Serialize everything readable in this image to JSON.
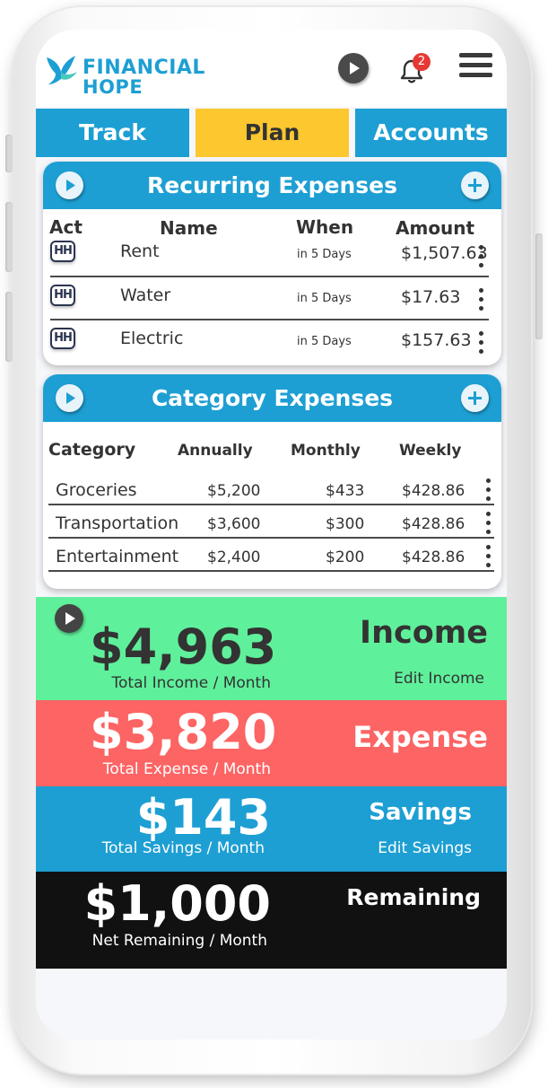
{
  "app": {
    "brand_line1": "FINANCIAL",
    "brand_line2": "HOPE",
    "notification_count": "2"
  },
  "tabs": [
    {
      "label": "Track",
      "active": false
    },
    {
      "label": "Plan",
      "active": true
    },
    {
      "label": "Accounts",
      "active": false
    }
  ],
  "recurring": {
    "title": "Recurring Expenses",
    "columns": {
      "act": "Act",
      "name": "Name",
      "when": "When",
      "amount": "Amount"
    },
    "rows": [
      {
        "act_icon": "HH",
        "name": "Rent",
        "when": "in 5 Days",
        "amount": "$1,507.63"
      },
      {
        "act_icon": "HH",
        "name": "Water",
        "when": "in 5 Days",
        "amount": "$17.63"
      },
      {
        "act_icon": "HH",
        "name": "Electric",
        "when": "in 5 Days",
        "amount": "$157.63"
      }
    ]
  },
  "category": {
    "title": "Category Expenses",
    "columns": {
      "category": "Category",
      "annually": "Annually",
      "monthly": "Monthly",
      "weekly": "Weekly"
    },
    "rows": [
      {
        "name": "Groceries",
        "annually": "$5,200",
        "monthly": "$433",
        "weekly": "$428.86"
      },
      {
        "name": "Transportation",
        "annually": "$3,600",
        "monthly": "$300",
        "weekly": "$428.86"
      },
      {
        "name": "Entertainment",
        "annually": "$2,400",
        "monthly": "$200",
        "weekly": "$428.86"
      }
    ]
  },
  "summary": {
    "income": {
      "amount": "$4,963",
      "caption": "Total Income / Month",
      "title": "Income",
      "action": "Edit Income"
    },
    "expense": {
      "amount": "$3,820",
      "caption": "Total Expense / Month",
      "title": "Expense"
    },
    "savings": {
      "amount": "$143",
      "caption": "Total Savings / Month",
      "title": "Savings",
      "action": "Edit Savings"
    },
    "remaining": {
      "amount": "$1,000",
      "caption": "Net Remaining / Month",
      "title": "Remaining"
    }
  },
  "colors": {
    "brand_blue": "#1d9fd3",
    "tab_active": "#fcc72f",
    "income_green": "#5ff09b",
    "expense_red": "#fd6464",
    "savings_blue": "#1d9fd3",
    "remaining_black": "#111111"
  },
  "icons": [
    "bird-logo-icon",
    "play-icon",
    "bell-icon",
    "menu-icon",
    "add-icon",
    "kebab-menu-icon",
    "hh-action-icon"
  ]
}
